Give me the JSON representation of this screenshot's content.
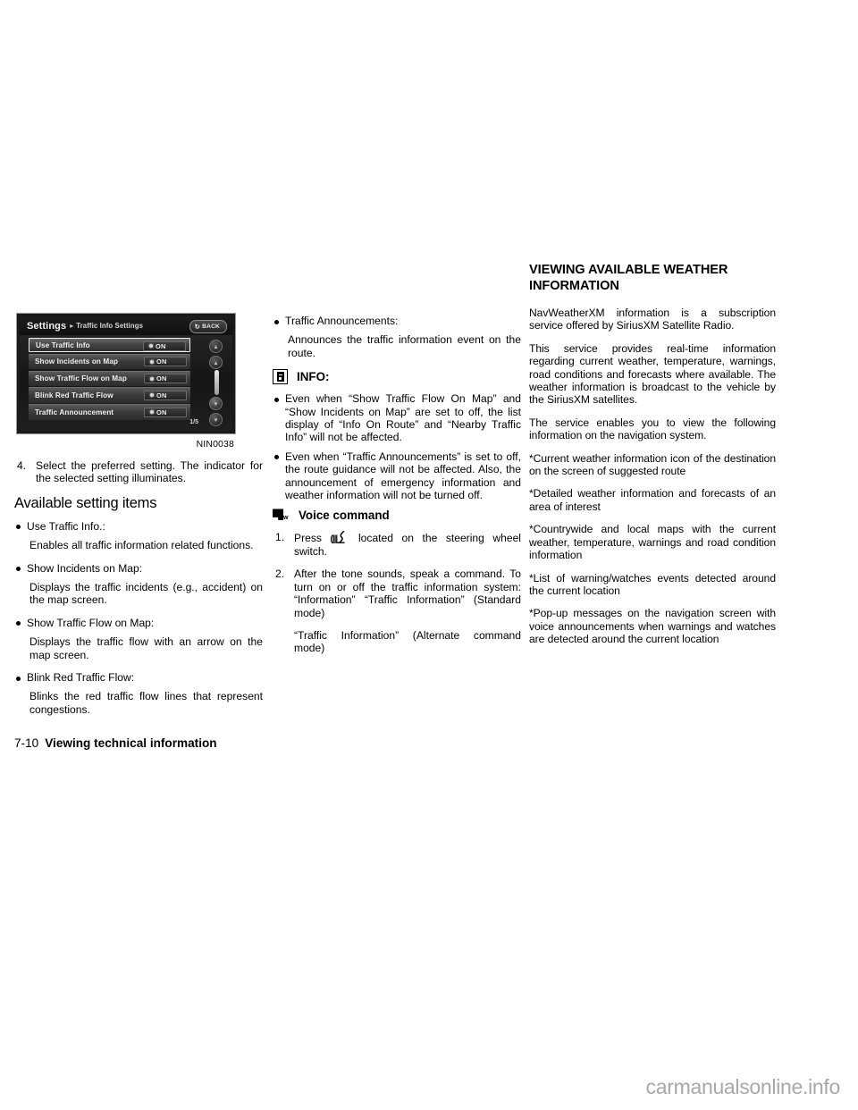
{
  "figure": {
    "caption": "NIN0038",
    "nav_screen": {
      "title": "Settings",
      "separator": "▸",
      "subtitle": "Traffic Info Settings",
      "back_label": "BACK",
      "back_icon": "back-arrow-icon",
      "page_indicator": "1/5",
      "rows": [
        {
          "label": "Use Traffic Info",
          "value": "ON",
          "selected": true
        },
        {
          "label": "Show Incidents on Map",
          "value": "ON",
          "selected": false
        },
        {
          "label": "Show Traffic Flow on Map",
          "value": "ON",
          "selected": false
        },
        {
          "label": "Blink Red Traffic Flow",
          "value": "ON",
          "selected": false
        },
        {
          "label": "Traffic Announcement",
          "value": "ON",
          "selected": false
        }
      ],
      "side_buttons": [
        {
          "name": "scroll-top-button",
          "glyph": "▴"
        },
        {
          "name": "scroll-up-button",
          "glyph": "▴"
        },
        {
          "name": "scroll-down-button",
          "glyph": "▾"
        },
        {
          "name": "scroll-bottom-button",
          "glyph": "▾"
        }
      ]
    }
  },
  "left_column": {
    "step4_num": "4.",
    "step4_text": "Select the preferred setting. The indicator for the selected setting illuminates.",
    "subhead": "Available setting items",
    "items": [
      {
        "title": "Use Traffic Info.:",
        "desc": "Enables all traffic information related functions."
      },
      {
        "title": "Show Incidents on Map:",
        "desc": "Displays the traffic incidents (e.g., accident) on the map screen."
      },
      {
        "title": "Show Traffic Flow on Map:",
        "desc": "Displays the traffic flow with an arrow on the map screen."
      },
      {
        "title": "Blink Red Traffic Flow:",
        "desc": "Blinks the red traffic flow lines that represent congestions."
      }
    ]
  },
  "middle_column": {
    "bullet_title": "Traffic Announcements:",
    "bullet_desc": "Announces the traffic information event on the route.",
    "info_heading": "INFO:",
    "info_icon": "info-icon",
    "info_bullets": [
      "Even when “Show Traffic Flow On Map” and “Show Incidents on Map” are set to off, the list display of “Info On Route” and “Nearby Traffic Info” will not be affected.",
      "Even when “Traffic Announcements” is set to off, the route guidance will not be affected. Also, the announcement of emergency information and weather information will not be turned off."
    ],
    "voice_heading": "Voice command",
    "voice_icon": "voice-command-icon",
    "steps": [
      {
        "num": "1.",
        "text_before": "Press",
        "icon": "steering-wheel-talk-icon",
        "text_after": "located on the steering wheel switch."
      },
      {
        "num": "2.",
        "text_before": "After the tone sounds, speak a command. To turn on or off the traffic information system: “Information” “Traffic Information” (Standard mode)",
        "icon": "",
        "text_after": ""
      }
    ],
    "alt_mode_text": "“Traffic Information” (Alternate command mode)"
  },
  "right_column": {
    "heading": "VIEWING AVAILABLE WEATHER INFORMATION",
    "paragraphs": [
      "NavWeatherXM information is a subscription service offered by SiriusXM Satellite Radio.",
      "This service provides real-time information regarding current weather, temperature, warnings, road conditions and forecasts where available. The weather information is broadcast to the vehicle by the SiriusXM satellites.",
      "The service enables you to view the following information on the navigation system.",
      "*Current weather information icon of the destination on the screen of suggested route",
      "*Detailed weather information and forecasts of an area of interest",
      "*Countrywide and local maps with the current weather, temperature, warnings and road condition information",
      "*List of warning/watches events detected around the current location",
      "*Pop-up messages on the navigation screen with voice announcements when warnings and watches are detected around the current location"
    ]
  },
  "footer": {
    "page_number": "7-10",
    "section_title": "Viewing technical information",
    "watermark": "carmanualsonline.info"
  }
}
